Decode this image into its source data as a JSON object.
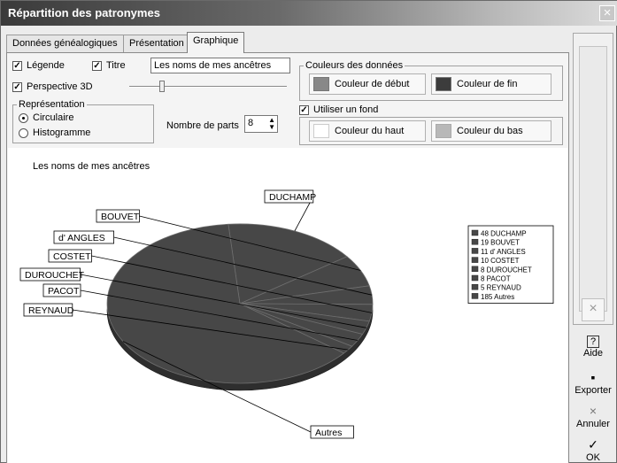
{
  "window": {
    "title": "Répartition des patronymes",
    "close_glyph": "×"
  },
  "tabs": [
    "Données généalogiques",
    "Présentation",
    "Graphique"
  ],
  "options": {
    "legende_label": "Légende",
    "titre_label": "Titre",
    "title_input_value": "Les noms de mes ancêtres",
    "perspective_label": "Perspective 3D",
    "perspective_level": 0.2,
    "representation_label": "Représentation",
    "circulaire_label": "Circulaire",
    "histogramme_label": "Histogramme",
    "nombre_parts_label": "Nombre de parts",
    "nombre_parts_value": "8",
    "couleurs_label": "Couleurs des données",
    "couleur_debut_label": "Couleur de début",
    "couleur_fin_label": "Couleur de fin",
    "utiliser_fond_label": "Utiliser un fond",
    "couleur_haut_label": "Couleur du haut",
    "couleur_bas_label": "Couleur du bas",
    "colors": {
      "debut": "#888888",
      "fin": "#3c3c3c",
      "haut": "#ffffff",
      "bas": "#b8b8b8"
    }
  },
  "chart_data": {
    "type": "pie",
    "title": "Les noms de mes ancêtres",
    "slice_color": "#474747",
    "slices": [
      {
        "label": "DUCHAMP",
        "value": 48
      },
      {
        "label": "BOUVET",
        "value": 19
      },
      {
        "label": "d' ANGLES",
        "value": 11
      },
      {
        "label": "COSTET",
        "value": 10
      },
      {
        "label": "DUROUCHET",
        "value": 8
      },
      {
        "label": "PACOT",
        "value": 8
      },
      {
        "label": "REYNAUD",
        "value": 5
      },
      {
        "label": "Autres",
        "value": 185
      }
    ],
    "legend": [
      "48  DUCHAMP",
      "19  BOUVET",
      "11 d' ANGLES",
      "10  COSTET",
      "8  DUROUCHET",
      "8  PACOT",
      "5  REYNAUD",
      "185 Autres"
    ],
    "legend_position": "top-right"
  },
  "sidebar": {
    "aide_label": "Aide",
    "exporter_label": "Exporter",
    "annuler_label": "Annuler",
    "ok_label": "OK",
    "icons": {
      "aide": "?",
      "exporter": "▪",
      "annuler": "×",
      "ok": "✓",
      "scroll": "×"
    }
  }
}
